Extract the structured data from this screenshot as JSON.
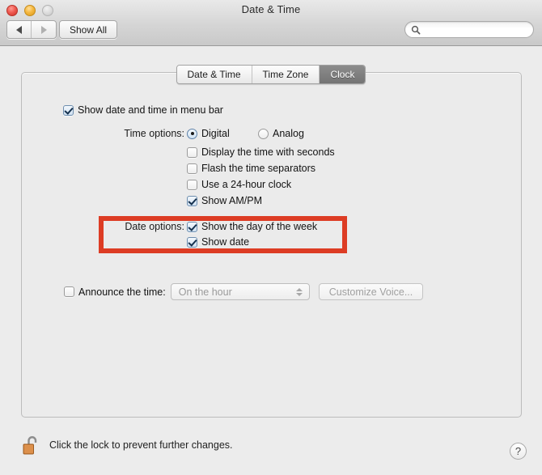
{
  "window": {
    "title": "Date & Time",
    "traffic_lights": [
      {
        "name": "close",
        "color": "#ef5b52"
      },
      {
        "name": "minimize",
        "color": "#f5b841"
      },
      {
        "name": "zoom",
        "color": "#dcdcdc"
      }
    ]
  },
  "toolbar": {
    "back_icon": "triangle-left-icon",
    "forward_icon": "triangle-right-icon",
    "show_all_label": "Show All",
    "search": {
      "value": "",
      "placeholder": "",
      "icon": "search-icon"
    }
  },
  "tabs": [
    {
      "label": "Date & Time",
      "selected": false
    },
    {
      "label": "Time Zone",
      "selected": false
    },
    {
      "label": "Clock",
      "selected": true
    }
  ],
  "clock_pane": {
    "show_in_menu_bar": {
      "label": "Show date and time in menu bar",
      "checked": true
    },
    "time_options": {
      "label": "Time options:",
      "radios": [
        {
          "label": "Digital",
          "selected": true
        },
        {
          "label": "Analog",
          "selected": false
        }
      ],
      "checkboxes": [
        {
          "label": "Display the time with seconds",
          "checked": false
        },
        {
          "label": "Flash the time separators",
          "checked": false
        },
        {
          "label": "Use a 24-hour clock",
          "checked": false
        },
        {
          "label": "Show AM/PM",
          "checked": true
        }
      ]
    },
    "date_options": {
      "label": "Date options:",
      "checkboxes": [
        {
          "label": "Show the day of the week",
          "checked": true
        },
        {
          "label": "Show date",
          "checked": true
        }
      ]
    },
    "announce": {
      "label": "Announce the time:",
      "checked": false,
      "enabled": false,
      "popup_value": "On the hour",
      "customize_button_label": "Customize Voice..."
    }
  },
  "annotation": {
    "color": "#dd3c24",
    "target": "date-options-group"
  },
  "footer": {
    "lock_icon": "unlocked-padlock-icon",
    "lock_text": "Click the lock to prevent further changes.",
    "help_label": "?"
  }
}
